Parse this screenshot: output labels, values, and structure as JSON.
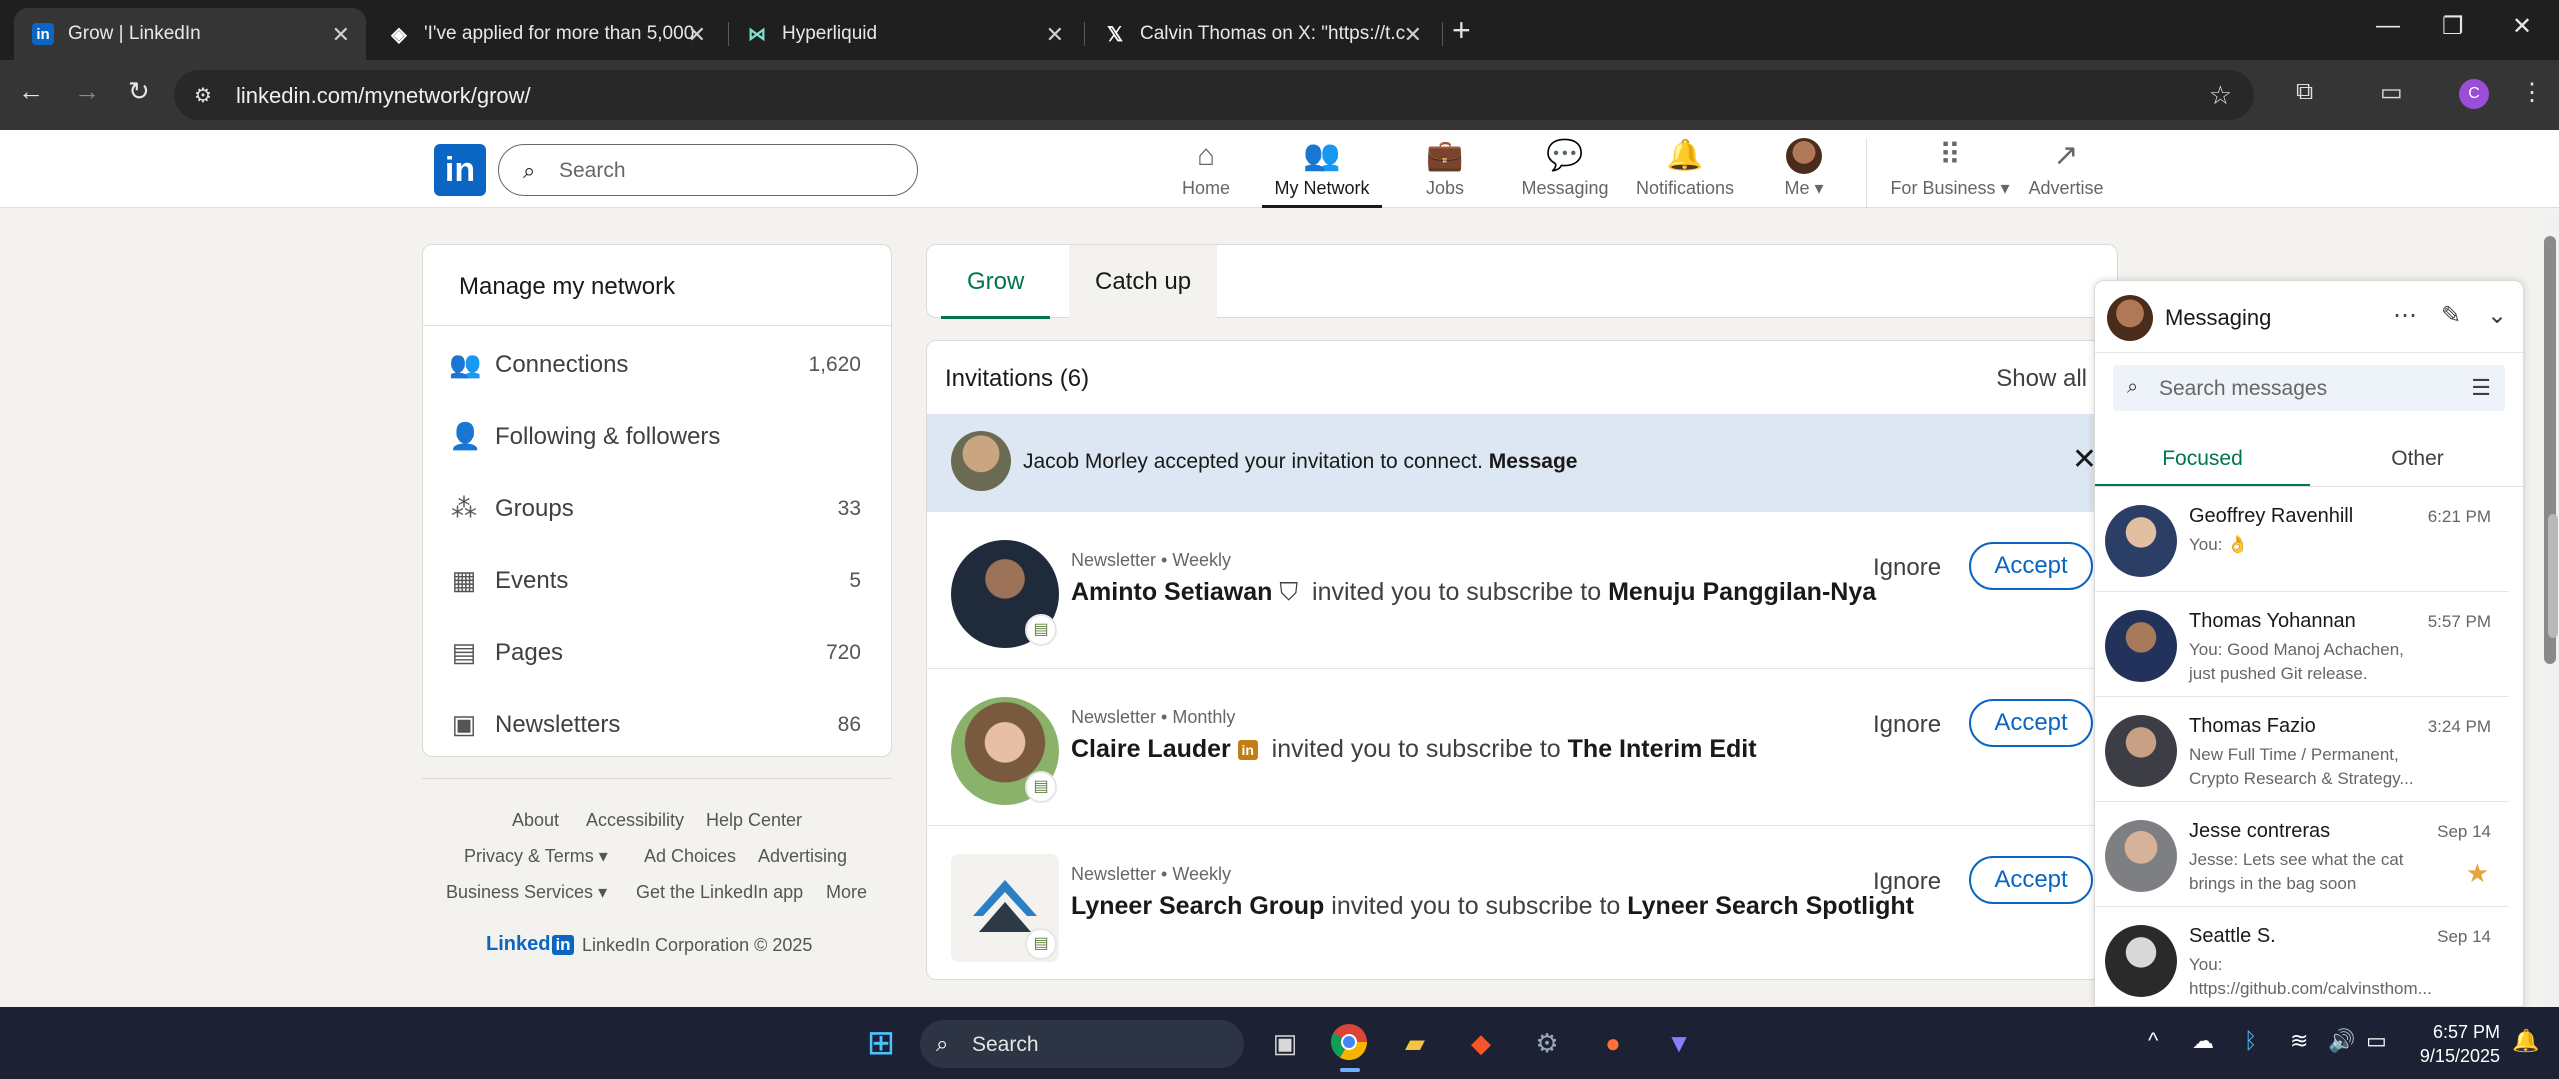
{
  "browser": {
    "tabs": [
      {
        "title": "Grow | LinkedIn",
        "icon": "linkedin-icon",
        "active": true
      },
      {
        "title": "'I've applied for more than 5,000",
        "icon": "diamond-icon",
        "active": false
      },
      {
        "title": "Hyperliquid",
        "icon": "hyperliquid-icon",
        "active": false
      },
      {
        "title": "Calvin Thomas on X: \"https://t.c",
        "icon": "x-icon",
        "active": false
      }
    ],
    "url": "linkedin.com/mynetwork/grow/",
    "profile_letter": "C"
  },
  "header": {
    "search_placeholder": "Search",
    "nav": [
      {
        "label": "Home",
        "icon": "home-icon"
      },
      {
        "label": "My Network",
        "icon": "network-icon"
      },
      {
        "label": "Jobs",
        "icon": "briefcase-icon"
      },
      {
        "label": "Messaging",
        "icon": "chat-icon"
      },
      {
        "label": "Notifications",
        "icon": "bell-icon"
      },
      {
        "label": "Me",
        "icon": "avatar"
      },
      {
        "label": "For Business",
        "icon": "grid-icon"
      },
      {
        "label": "Advertise",
        "icon": "advertise-icon"
      }
    ]
  },
  "sidebar": {
    "title": "Manage my network",
    "items": [
      {
        "label": "Connections",
        "count": "1,620",
        "icon": "people-icon"
      },
      {
        "label": "Following & followers",
        "count": "",
        "icon": "person-icon"
      },
      {
        "label": "Groups",
        "count": "33",
        "icon": "groups-icon"
      },
      {
        "label": "Events",
        "count": "5",
        "icon": "calendar-icon"
      },
      {
        "label": "Pages",
        "count": "720",
        "icon": "building-icon"
      },
      {
        "label": "Newsletters",
        "count": "86",
        "icon": "newspaper-icon"
      }
    ]
  },
  "footer": {
    "links": [
      "About",
      "Accessibility",
      "Help Center",
      "Privacy & Terms",
      "Ad Choices",
      "Advertising",
      "Business Services",
      "Get the LinkedIn app",
      "More"
    ],
    "brand": "Linked",
    "brand_in": "in",
    "copyright": "LinkedIn Corporation © 2025"
  },
  "main": {
    "tabs": [
      "Grow",
      "Catch up"
    ],
    "invitations_title": "Invitations (6)",
    "show_all": "Show all",
    "notice": {
      "name": "Jacob Morley",
      "text": " accepted your invitation to connect. ",
      "action": "Message"
    },
    "invites": [
      {
        "sub": "Newsletter • Weekly",
        "name": "Aminto Setiawan",
        "verified": "shield-check-icon",
        "middle": "invited you to subscribe to",
        "target": "Menuju Panggilan-Nya",
        "ignore": "Ignore",
        "accept": "Accept"
      },
      {
        "sub": "Newsletter • Monthly",
        "name": "Claire Lauder",
        "verified": "linkedin-premium-icon",
        "middle": "invited you to subscribe to",
        "target": "The Interim Edit",
        "ignore": "Ignore",
        "accept": "Accept"
      },
      {
        "sub": "Newsletter • Weekly",
        "name": "Lyneer Search Group",
        "verified": "",
        "middle": "invited you to subscribe to",
        "target": "Lyneer Search Spotlight",
        "ignore": "Ignore",
        "accept": "Accept"
      }
    ]
  },
  "messaging": {
    "title": "Messaging",
    "search_placeholder": "Search messages",
    "tabs": [
      "Focused",
      "Other"
    ],
    "conversations": [
      {
        "name": "Geoffrey Ravenhill",
        "time": "6:21 PM",
        "preview": "You: 👌"
      },
      {
        "name": "Thomas Yohannan",
        "time": "5:57 PM",
        "preview": "You: Good Manoj Achachen, just pushed Git release."
      },
      {
        "name": "Thomas Fazio",
        "time": "3:24 PM",
        "preview": "New Full Time / Permanent, Crypto Research & Strategy..."
      },
      {
        "name": "Jesse contreras",
        "time": "Sep 14",
        "preview": "Jesse: Lets see what the cat brings in the bag soon",
        "starred": true
      },
      {
        "name": "Seattle S.",
        "time": "Sep 14",
        "preview": "You: https://github.com/calvinsthom..."
      }
    ]
  },
  "taskbar": {
    "search_placeholder": "Search",
    "time": "6:57 PM",
    "date": "9/15/2025"
  }
}
